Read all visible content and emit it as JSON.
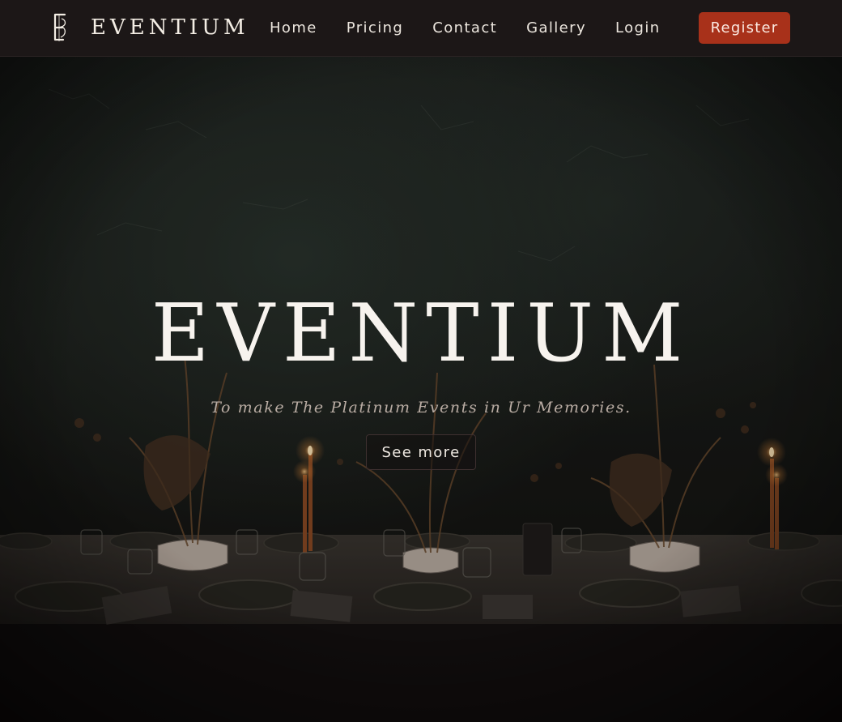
{
  "brand": {
    "name": "EVENTIUM",
    "icon": "e-monogram-icon"
  },
  "nav": {
    "items": [
      {
        "label": "Home"
      },
      {
        "label": "Pricing"
      },
      {
        "label": "Contact"
      },
      {
        "label": "Gallery"
      },
      {
        "label": "Login"
      }
    ],
    "register_label": "Register"
  },
  "hero": {
    "title": "EVENTIUM",
    "tagline": "To make The Platinum Events in Ur Memories.",
    "cta_label": "See more"
  },
  "colors": {
    "nav_background": "#1c1717",
    "accent": "#a8311a",
    "text_primary": "#f7f3ee",
    "text_muted": "#b9aca3"
  }
}
